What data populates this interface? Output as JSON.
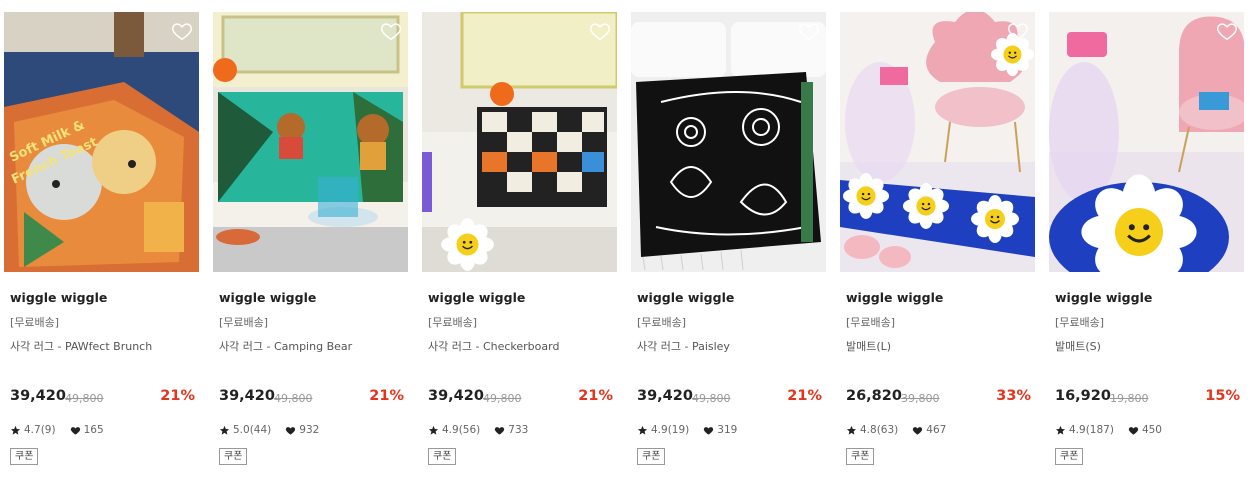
{
  "icons": {
    "wishlist": "heart-outline-icon",
    "star": "star-icon",
    "like": "heart-filled-icon"
  },
  "colors": {
    "discount": "#e4341d",
    "text": "#222222",
    "muted": "#999999"
  },
  "products": [
    {
      "brand": "wiggle wiggle",
      "shipping": "[무료배송]",
      "name": "사각 러그 - PAWfect Brunch",
      "price": "39,420",
      "original_price": "49,800",
      "discount": "21%",
      "rating": "4.7(9)",
      "likes": "165",
      "coupon": "쿠폰"
    },
    {
      "brand": "wiggle wiggle",
      "shipping": "[무료배송]",
      "name": "사각 러그 - Camping Bear",
      "price": "39,420",
      "original_price": "49,800",
      "discount": "21%",
      "rating": "5.0(44)",
      "likes": "932",
      "coupon": "쿠폰"
    },
    {
      "brand": "wiggle wiggle",
      "shipping": "[무료배송]",
      "name": "사각 러그 - Checkerboard",
      "price": "39,420",
      "original_price": "49,800",
      "discount": "21%",
      "rating": "4.9(56)",
      "likes": "733",
      "coupon": "쿠폰"
    },
    {
      "brand": "wiggle wiggle",
      "shipping": "[무료배송]",
      "name": "사각 러그 - Paisley",
      "price": "39,420",
      "original_price": "49,800",
      "discount": "21%",
      "rating": "4.9(19)",
      "likes": "319",
      "coupon": "쿠폰"
    },
    {
      "brand": "wiggle wiggle",
      "shipping": "[무료배송]",
      "name": "발매트(L)",
      "price": "26,820",
      "original_price": "39,800",
      "discount": "33%",
      "rating": "4.8(63)",
      "likes": "467",
      "coupon": "쿠폰"
    },
    {
      "brand": "wiggle wiggle",
      "shipping": "[무료배송]",
      "name": "발매트(S)",
      "price": "16,920",
      "original_price": "19,800",
      "discount": "15%",
      "rating": "4.9(187)",
      "likes": "450",
      "coupon": "쿠폰"
    }
  ]
}
